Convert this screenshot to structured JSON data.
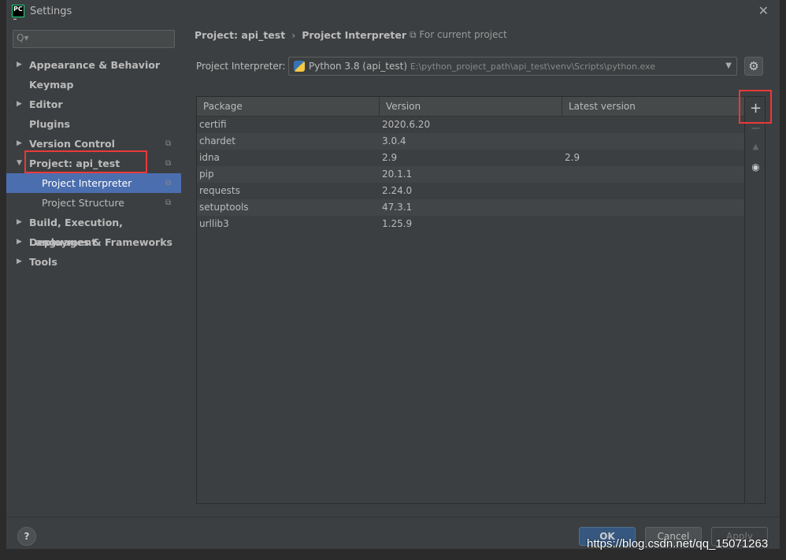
{
  "window": {
    "title": "Settings",
    "logo": "PC",
    "close_icon": "close-icon"
  },
  "sidebar": {
    "search_placeholder": "Q▾",
    "items": [
      {
        "label": "Appearance & Behavior",
        "arrow": "▶"
      },
      {
        "label": "Keymap",
        "arrow": ""
      },
      {
        "label": "Editor",
        "arrow": "▶"
      },
      {
        "label": "Plugins",
        "arrow": ""
      },
      {
        "label": "Version Control",
        "arrow": "▶",
        "copy": "⧉"
      },
      {
        "label": "Project: api_test",
        "arrow": "▼",
        "copy": "⧉"
      },
      {
        "label": "Project Interpreter",
        "copy": "⧉",
        "selected": true
      },
      {
        "label": "Project Structure",
        "copy": "⧉"
      },
      {
        "label": "Build, Execution, Deployment",
        "arrow": "▶"
      },
      {
        "label": "Languages & Frameworks",
        "arrow": "▶"
      },
      {
        "label": "Tools",
        "arrow": "▶"
      }
    ]
  },
  "main": {
    "breadcrumb": [
      "Project: api_test",
      "Project Interpreter"
    ],
    "breadcrumb_sep": "›",
    "for_current": "⧉ For current project",
    "interpreter_label": "Project Interpreter:",
    "interpreter_name": "Python 3.8 (api_test)",
    "interpreter_path": "E:\\python_project_path\\api_test\\venv\\Scripts\\python.exe",
    "table": {
      "columns": [
        "Package",
        "Version",
        "Latest version"
      ],
      "rows": [
        [
          "certifi",
          "2020.6.20",
          ""
        ],
        [
          "chardet",
          "3.0.4",
          ""
        ],
        [
          "idna",
          "2.9",
          "2.9"
        ],
        [
          "pip",
          "20.1.1",
          ""
        ],
        [
          "requests",
          "2.24.0",
          ""
        ],
        [
          "setuptools",
          "47.3.1",
          ""
        ],
        [
          "urllib3",
          "1.25.9",
          ""
        ]
      ]
    },
    "tools": {
      "add": "+",
      "remove": "−",
      "upgrade": "▲",
      "show": "👁"
    }
  },
  "footer": {
    "help": "?",
    "ok": "OK",
    "cancel": "Cancel",
    "apply": "Apply"
  },
  "watermark": "https://blog.csdn.net/qq_15071263",
  "colors": {
    "accent": "#4b6eaf",
    "highlight": "#e8393a",
    "ok": "#365880"
  }
}
